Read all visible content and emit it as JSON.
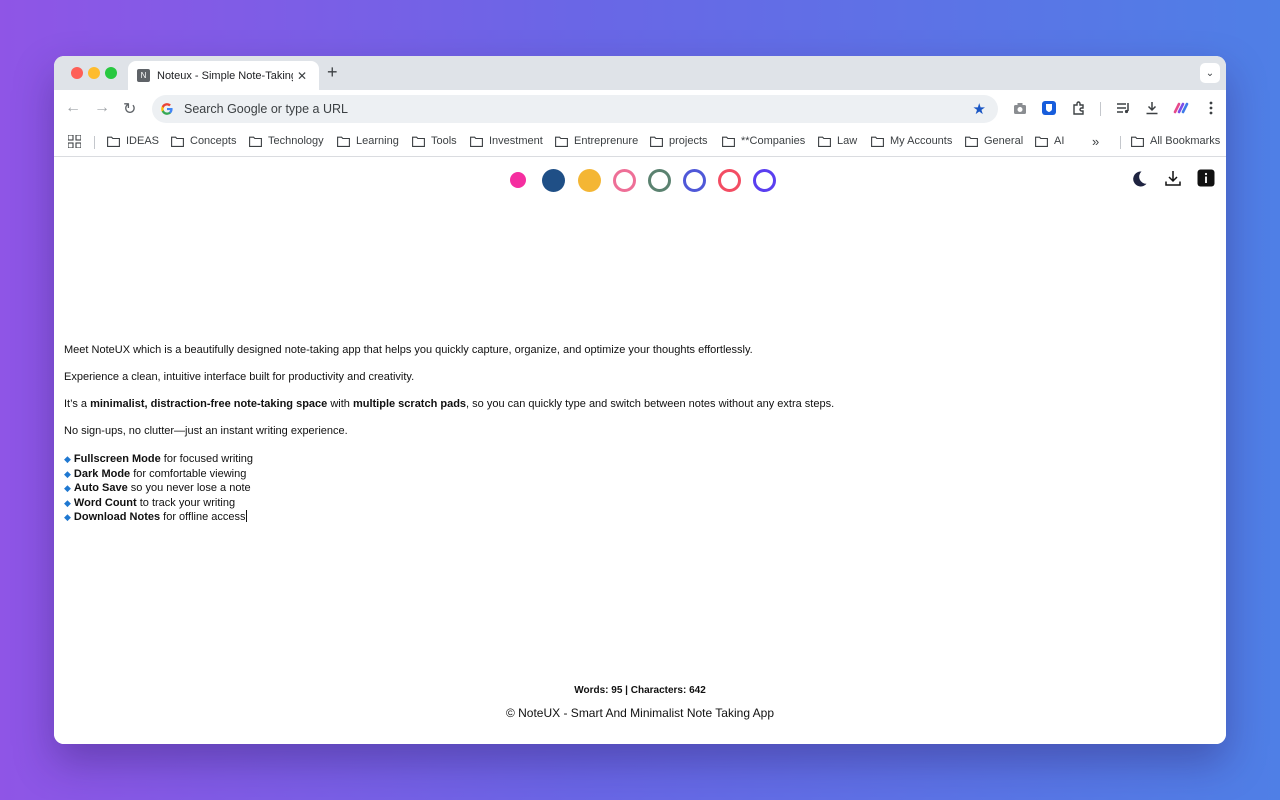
{
  "browser": {
    "tab_title": "Noteux - Simple Note-Taking",
    "tab_favicon_letter": "N",
    "new_tab_label": "+",
    "omnibox_placeholder": "Search Google or type a URL",
    "icons": [
      "back-arrow-icon",
      "forward-arrow-icon",
      "reload-icon",
      "google-g-icon",
      "star-icon",
      "camera-icon",
      "password-manager-icon",
      "extensions-icon",
      "media-queue-icon",
      "download-icon",
      "extension-logo-icon",
      "more-vert-icon"
    ]
  },
  "bookmarks": {
    "items": [
      "IDEAS",
      "Concepts",
      "Technology",
      "Learning",
      "Tools",
      "Investment",
      "Entreprenure",
      "projects",
      "**Companies",
      "Law",
      "My Accounts",
      "General",
      "AI"
    ],
    "more_label": "»",
    "all_bookmarks_label": "All Bookmarks"
  },
  "palette": {
    "colors": [
      "#f52ea0",
      "#1f4f86",
      "#f4b634",
      "#ee6f97",
      "#5b8270",
      "#4f58d8",
      "#f34d63",
      "#5a3ff0"
    ],
    "filled": [
      true,
      true,
      true,
      false,
      false,
      false,
      false,
      false
    ]
  },
  "note": {
    "p1": "Meet NoteUX which is a beautifully designed note-taking app that helps you quickly capture, organize, and optimize your thoughts effortlessly.",
    "p2": "Experience a clean, intuitive interface built for productivity and creativity.",
    "p3_a": "It’s a ",
    "p3_b": "minimalist, distraction-free note-taking space",
    "p3_c": " with ",
    "p3_d": "multiple scratch pads",
    "p3_e": ", so you can quickly type and switch between notes without any extra steps.",
    "p4": "No sign-ups, no clutter—just an instant writing experience.",
    "features": [
      {
        "bold": "Fullscreen Mode",
        "rest": " for focused writing"
      },
      {
        "bold": "Dark Mode",
        "rest": " for comfortable viewing"
      },
      {
        "bold": "Auto Save",
        "rest": " so you never lose a note"
      },
      {
        "bold": "Word Count",
        "rest": " to track your writing"
      },
      {
        "bold": "Download Notes",
        "rest": " for offline access"
      }
    ],
    "bullet": "🔹"
  },
  "status": {
    "counts": "Words: 95 | Characters: 642"
  },
  "footer": {
    "text": "© NoteUX - Smart And Minimalist Note Taking App"
  }
}
